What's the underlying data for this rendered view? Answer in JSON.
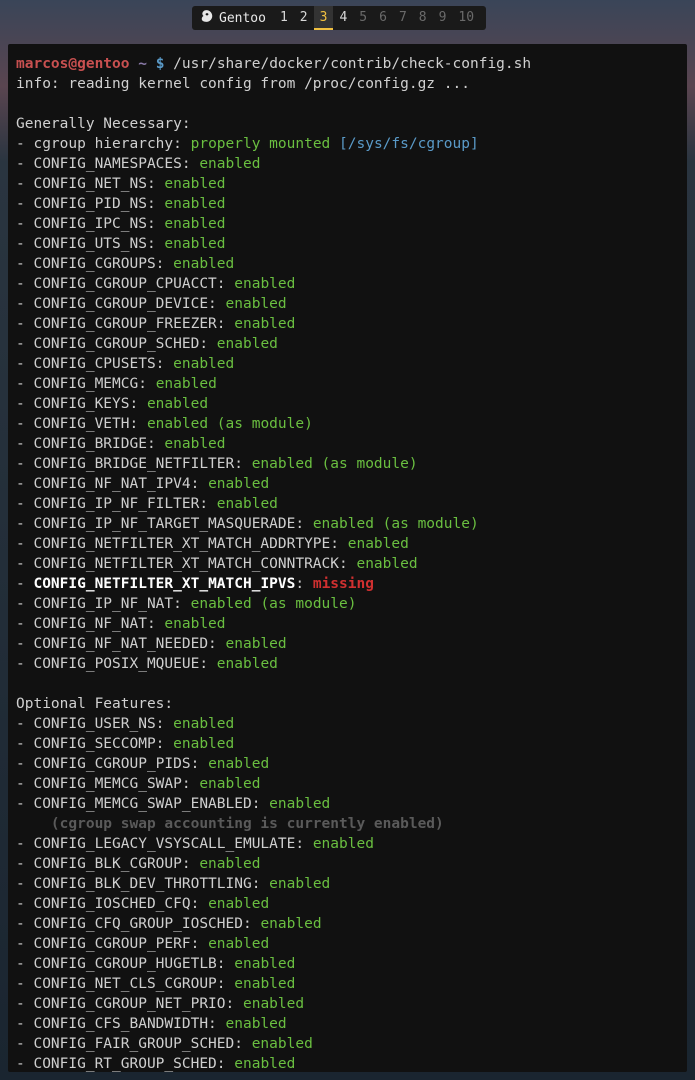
{
  "tabbar": {
    "title": "Gentoo",
    "tabs": [
      "1",
      "2",
      "3",
      "4",
      "5",
      "6",
      "7",
      "8",
      "9",
      "10"
    ],
    "available": [
      1,
      2,
      3,
      4
    ],
    "active": 3
  },
  "prompt": {
    "user": "marcos@gentoo",
    "path": "~",
    "symbol": "$",
    "command": "/usr/share/docker/contrib/check-config.sh"
  },
  "info_line": "info: reading kernel config from /proc/config.gz ...",
  "section1": {
    "header": "Generally Necessary:",
    "cgroup_label": "cgroup hierarchy:",
    "cgroup_status": "properly mounted",
    "cgroup_path": "[/sys/fs/cgroup]",
    "items": [
      {
        "k": "CONFIG_NAMESPACES",
        "v": "enabled"
      },
      {
        "k": "CONFIG_NET_NS",
        "v": "enabled"
      },
      {
        "k": "CONFIG_PID_NS",
        "v": "enabled"
      },
      {
        "k": "CONFIG_IPC_NS",
        "v": "enabled"
      },
      {
        "k": "CONFIG_UTS_NS",
        "v": "enabled"
      },
      {
        "k": "CONFIG_CGROUPS",
        "v": "enabled"
      },
      {
        "k": "CONFIG_CGROUP_CPUACCT",
        "v": "enabled"
      },
      {
        "k": "CONFIG_CGROUP_DEVICE",
        "v": "enabled"
      },
      {
        "k": "CONFIG_CGROUP_FREEZER",
        "v": "enabled"
      },
      {
        "k": "CONFIG_CGROUP_SCHED",
        "v": "enabled"
      },
      {
        "k": "CONFIG_CPUSETS",
        "v": "enabled"
      },
      {
        "k": "CONFIG_MEMCG",
        "v": "enabled"
      },
      {
        "k": "CONFIG_KEYS",
        "v": "enabled"
      },
      {
        "k": "CONFIG_VETH",
        "v": "enabled (as module)"
      },
      {
        "k": "CONFIG_BRIDGE",
        "v": "enabled"
      },
      {
        "k": "CONFIG_BRIDGE_NETFILTER",
        "v": "enabled (as module)"
      },
      {
        "k": "CONFIG_NF_NAT_IPV4",
        "v": "enabled"
      },
      {
        "k": "CONFIG_IP_NF_FILTER",
        "v": "enabled"
      },
      {
        "k": "CONFIG_IP_NF_TARGET_MASQUERADE",
        "v": "enabled (as module)"
      },
      {
        "k": "CONFIG_NETFILTER_XT_MATCH_ADDRTYPE",
        "v": "enabled"
      },
      {
        "k": "CONFIG_NETFILTER_XT_MATCH_CONNTRACK",
        "v": "enabled"
      },
      {
        "k": "CONFIG_NETFILTER_XT_MATCH_IPVS",
        "v": "missing",
        "missing": true
      },
      {
        "k": "CONFIG_IP_NF_NAT",
        "v": "enabled (as module)"
      },
      {
        "k": "CONFIG_NF_NAT",
        "v": "enabled"
      },
      {
        "k": "CONFIG_NF_NAT_NEEDED",
        "v": "enabled"
      },
      {
        "k": "CONFIG_POSIX_MQUEUE",
        "v": "enabled"
      }
    ]
  },
  "section2": {
    "header": "Optional Features:",
    "swap_note": "(cgroup swap accounting is currently enabled)",
    "items": [
      {
        "k": "CONFIG_USER_NS",
        "v": "enabled"
      },
      {
        "k": "CONFIG_SECCOMP",
        "v": "enabled"
      },
      {
        "k": "CONFIG_CGROUP_PIDS",
        "v": "enabled"
      },
      {
        "k": "CONFIG_MEMCG_SWAP",
        "v": "enabled"
      },
      {
        "k": "CONFIG_MEMCG_SWAP_ENABLED",
        "v": "enabled",
        "note": true
      },
      {
        "k": "CONFIG_LEGACY_VSYSCALL_EMULATE",
        "v": "enabled"
      },
      {
        "k": "CONFIG_BLK_CGROUP",
        "v": "enabled"
      },
      {
        "k": "CONFIG_BLK_DEV_THROTTLING",
        "v": "enabled"
      },
      {
        "k": "CONFIG_IOSCHED_CFQ",
        "v": "enabled"
      },
      {
        "k": "CONFIG_CFQ_GROUP_IOSCHED",
        "v": "enabled"
      },
      {
        "k": "CONFIG_CGROUP_PERF",
        "v": "enabled"
      },
      {
        "k": "CONFIG_CGROUP_HUGETLB",
        "v": "enabled"
      },
      {
        "k": "CONFIG_NET_CLS_CGROUP",
        "v": "enabled"
      },
      {
        "k": "CONFIG_CGROUP_NET_PRIO",
        "v": "enabled"
      },
      {
        "k": "CONFIG_CFS_BANDWIDTH",
        "v": "enabled"
      },
      {
        "k": "CONFIG_FAIR_GROUP_SCHED",
        "v": "enabled"
      },
      {
        "k": "CONFIG_RT_GROUP_SCHED",
        "v": "enabled"
      }
    ]
  }
}
